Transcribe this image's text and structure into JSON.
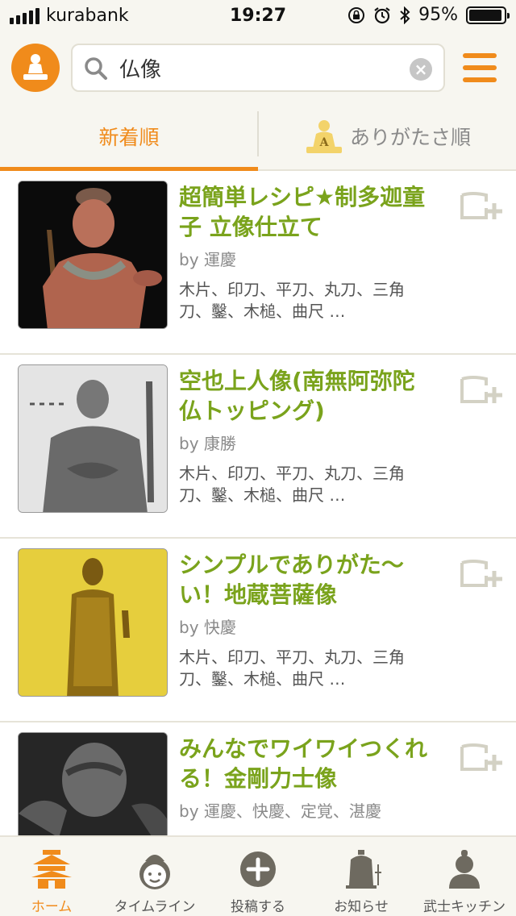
{
  "status_bar": {
    "carrier": "kurabank",
    "time": "19:27",
    "battery": "95%",
    "battery_level": 0.95
  },
  "search": {
    "value": "仏像"
  },
  "tabs": [
    {
      "label": "新着順",
      "active": true
    },
    {
      "label": "ありがたさ順",
      "badge": "A",
      "active": false
    }
  ],
  "items": [
    {
      "title": "超簡単レシピ★制多迦童子 立像仕立て",
      "author": "by 運慶",
      "tools": "木片、印刀、平刀、丸刀、三角刀、鑿、木槌、曲尺 …"
    },
    {
      "title": "空也上人像(南無阿弥陀仏トッピング)",
      "author": "by 康勝",
      "tools": "木片、印刀、平刀、丸刀、三角刀、鑿、木槌、曲尺 …"
    },
    {
      "title": "シンプルでありがた〜い！地蔵菩薩像",
      "author": "by 快慶",
      "tools": "木片、印刀、平刀、丸刀、三角刀、鑿、木槌、曲尺 …"
    },
    {
      "title": "みんなでワイワイつくれる！金剛力士像",
      "author": "by 運慶、快慶、定覚、湛慶",
      "tools": ""
    }
  ],
  "bottom_nav": [
    {
      "label": "ホーム",
      "icon": "home-temple-icon",
      "active": true
    },
    {
      "label": "タイムライン",
      "icon": "monk-face-icon",
      "active": false
    },
    {
      "label": "投稿する",
      "icon": "plus-circle-icon",
      "active": false
    },
    {
      "label": "お知らせ",
      "icon": "temple-bell-icon",
      "active": false
    },
    {
      "label": "武士キッチン",
      "icon": "samurai-person-icon",
      "active": false
    }
  ],
  "colors": {
    "accent": "#f08b1b",
    "title_green": "#7aa31c",
    "background": "#f7f6f0"
  }
}
